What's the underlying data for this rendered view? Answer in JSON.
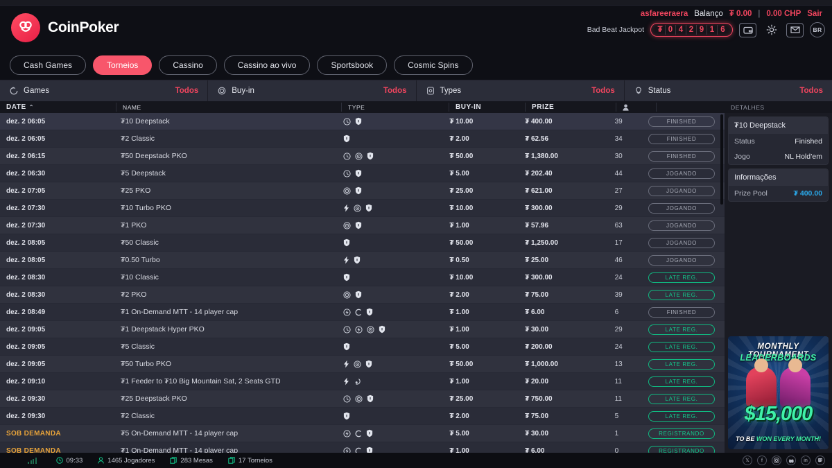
{
  "brand": {
    "name": "CoinPoker"
  },
  "account": {
    "username": "asfareeraera",
    "balance_label": "Balanço",
    "balance_value": "₮ 0.00",
    "separator": "|",
    "chp_value": "0.00 CHP",
    "logout": "Sair"
  },
  "jackpot": {
    "label": "Bad Beat Jackpot",
    "symbol": "₮",
    "digits": [
      "0",
      "4",
      "2",
      "9",
      "1",
      "6"
    ]
  },
  "header_icons": [
    {
      "name": "wallet-icon",
      "label": ""
    },
    {
      "name": "gear-icon",
      "label": ""
    },
    {
      "name": "mail-icon",
      "label": ""
    },
    {
      "name": "language-badge",
      "label": "BR"
    }
  ],
  "nav": {
    "tabs": [
      {
        "label": "Cash Games",
        "active": false
      },
      {
        "label": "Torneios",
        "active": true
      },
      {
        "label": "Cassino",
        "active": false
      },
      {
        "label": "Cassino ao vivo",
        "active": false
      },
      {
        "label": "Sportsbook",
        "active": false
      },
      {
        "label": "Cosmic Spins",
        "active": false
      }
    ]
  },
  "filters": [
    {
      "icon": "games-icon",
      "label": "Games",
      "value": "Todos"
    },
    {
      "icon": "buyin-icon",
      "label": "Buy-in",
      "value": "Todos"
    },
    {
      "icon": "types-icon",
      "label": "Types",
      "value": "Todos"
    },
    {
      "icon": "status-icon",
      "label": "Status",
      "value": "Todos"
    }
  ],
  "table": {
    "columns": {
      "date": "DATE",
      "sort_indicator": "⌃",
      "name": "NAME",
      "type": "TYPE",
      "buyin": "BUY-IN",
      "prize": "PRIZE",
      "players": "",
      "status": ""
    },
    "rows": [
      {
        "date": "dez. 2 06:05",
        "on_demand": false,
        "name": "₮10 Deepstack",
        "types": [
          "clock",
          "shield"
        ],
        "buyin": "₮ 10.00",
        "prize": "₮ 400.00",
        "players": "39",
        "status": "FINISHED",
        "status_color": "grey",
        "selected": true
      },
      {
        "date": "dez. 2 06:05",
        "on_demand": false,
        "name": "₮2 Classic",
        "types": [
          "shield"
        ],
        "buyin": "₮ 2.00",
        "prize": "₮ 62.56",
        "players": "34",
        "status": "FINISHED",
        "status_color": "grey",
        "selected": false
      },
      {
        "date": "dez. 2 06:15",
        "on_demand": false,
        "name": "₮50 Deepstack PKO",
        "types": [
          "clock",
          "target",
          "shield"
        ],
        "buyin": "₮ 50.00",
        "prize": "₮ 1,380.00",
        "players": "30",
        "status": "FINISHED",
        "status_color": "grey",
        "selected": false
      },
      {
        "date": "dez. 2 06:30",
        "on_demand": false,
        "name": "₮5 Deepstack",
        "types": [
          "clock",
          "shield"
        ],
        "buyin": "₮ 5.00",
        "prize": "₮ 202.40",
        "players": "44",
        "status": "JOGANDO",
        "status_color": "grey",
        "selected": false
      },
      {
        "date": "dez. 2 07:05",
        "on_demand": false,
        "name": "₮25 PKO",
        "types": [
          "target",
          "shield"
        ],
        "buyin": "₮ 25.00",
        "prize": "₮ 621.00",
        "players": "27",
        "status": "JOGANDO",
        "status_color": "grey",
        "selected": false
      },
      {
        "date": "dez. 2 07:30",
        "on_demand": false,
        "name": "₮10 Turbo PKO",
        "types": [
          "bolt",
          "target",
          "shield"
        ],
        "buyin": "₮ 10.00",
        "prize": "₮ 300.00",
        "players": "29",
        "status": "JOGANDO",
        "status_color": "grey",
        "selected": false
      },
      {
        "date": "dez. 2 07:30",
        "on_demand": false,
        "name": "₮1 PKO",
        "types": [
          "target",
          "shield"
        ],
        "buyin": "₮ 1.00",
        "prize": "₮ 57.96",
        "players": "63",
        "status": "JOGANDO",
        "status_color": "grey",
        "selected": false
      },
      {
        "date": "dez. 2 08:05",
        "on_demand": false,
        "name": "₮50 Classic",
        "types": [
          "shield"
        ],
        "buyin": "₮ 50.00",
        "prize": "₮ 1,250.00",
        "players": "17",
        "status": "JOGANDO",
        "status_color": "grey",
        "selected": false
      },
      {
        "date": "dez. 2 08:05",
        "on_demand": false,
        "name": "₮0.50 Turbo",
        "types": [
          "bolt",
          "shield"
        ],
        "buyin": "₮ 0.50",
        "prize": "₮ 25.00",
        "players": "46",
        "status": "JOGANDO",
        "status_color": "grey",
        "selected": false
      },
      {
        "date": "dez. 2 08:30",
        "on_demand": false,
        "name": "₮10 Classic",
        "types": [
          "shield"
        ],
        "buyin": "₮ 10.00",
        "prize": "₮ 300.00",
        "players": "24",
        "status": "LATE REG.",
        "status_color": "green",
        "selected": false
      },
      {
        "date": "dez. 2 08:30",
        "on_demand": false,
        "name": "₮2 PKO",
        "types": [
          "target",
          "shield"
        ],
        "buyin": "₮ 2.00",
        "prize": "₮ 75.00",
        "players": "39",
        "status": "LATE REG.",
        "status_color": "green",
        "selected": false
      },
      {
        "date": "dez. 2 08:49",
        "on_demand": false,
        "name": "₮1 On-Demand MTT - 14 player cap",
        "types": [
          "hyper",
          "cap",
          "shield"
        ],
        "buyin": "₮ 1.00",
        "prize": "₮ 6.00",
        "players": "6",
        "status": "FINISHED",
        "status_color": "grey",
        "selected": false
      },
      {
        "date": "dez. 2 09:05",
        "on_demand": false,
        "name": "₮1 Deepstack Hyper PKO",
        "types": [
          "clock",
          "hyper",
          "target",
          "shield"
        ],
        "buyin": "₮ 1.00",
        "prize": "₮ 30.00",
        "players": "29",
        "status": "LATE REG.",
        "status_color": "green",
        "selected": false
      },
      {
        "date": "dez. 2 09:05",
        "on_demand": false,
        "name": "₮5 Classic",
        "types": [
          "shield"
        ],
        "buyin": "₮ 5.00",
        "prize": "₮ 200.00",
        "players": "24",
        "status": "LATE REG.",
        "status_color": "green",
        "selected": false
      },
      {
        "date": "dez. 2 09:05",
        "on_demand": false,
        "name": "₮50 Turbo PKO",
        "types": [
          "bolt",
          "target",
          "shield"
        ],
        "buyin": "₮ 50.00",
        "prize": "₮ 1,000.00",
        "players": "13",
        "status": "LATE REG.",
        "status_color": "green",
        "selected": false
      },
      {
        "date": "dez. 2 09:10",
        "on_demand": false,
        "name": "₮1 Feeder to ₮10 Big Mountain Sat, 2 Seats GTD",
        "types": [
          "bolt",
          "sat"
        ],
        "buyin": "₮ 1.00",
        "prize": "₮ 20.00",
        "players": "11",
        "status": "LATE REG.",
        "status_color": "green",
        "selected": false
      },
      {
        "date": "dez. 2 09:30",
        "on_demand": false,
        "name": "₮25 Deepstack PKO",
        "types": [
          "clock",
          "target",
          "shield"
        ],
        "buyin": "₮ 25.00",
        "prize": "₮ 750.00",
        "players": "11",
        "status": "LATE REG.",
        "status_color": "green",
        "selected": false
      },
      {
        "date": "dez. 2 09:30",
        "on_demand": false,
        "name": "₮2 Classic",
        "types": [
          "shield"
        ],
        "buyin": "₮ 2.00",
        "prize": "₮ 75.00",
        "players": "5",
        "status": "LATE REG.",
        "status_color": "green",
        "selected": false
      },
      {
        "date": "SOB DEMANDA",
        "on_demand": true,
        "name": "₮5 On-Demand MTT - 14 player cap",
        "types": [
          "hyper",
          "cap",
          "shield"
        ],
        "buyin": "₮ 5.00",
        "prize": "₮ 30.00",
        "players": "1",
        "status": "REGISTRANDO",
        "status_color": "green",
        "selected": false
      },
      {
        "date": "SOB DEMANDA",
        "on_demand": true,
        "name": "₮1 On-Demand MTT - 14 player cap",
        "types": [
          "hyper",
          "cap",
          "shield"
        ],
        "buyin": "₮ 1.00",
        "prize": "₮ 6.00",
        "players": "0",
        "status": "REGISTRANDO",
        "status_color": "green",
        "selected": false
      }
    ]
  },
  "details": {
    "header": "DETALHES",
    "tournament_title": "₮10 Deepstack",
    "fields": [
      {
        "key": "Status",
        "value": "Finished"
      },
      {
        "key": "Jogo",
        "value": "NL Hold’em"
      }
    ],
    "info_title": "Informações",
    "info_fields": [
      {
        "key": "Prize Pool",
        "value": "₮ 400.00"
      }
    ]
  },
  "promo": {
    "line1": "MONTHLY TOURNAMENT",
    "line2": "LEADERBOARDS",
    "amount": "$15,000",
    "line3_pre": "TO BE ",
    "line3_em": "WON EVERY MONTH!"
  },
  "statusbar": {
    "time": "09:33",
    "players": "1465 Jogadores",
    "tables": "283 Mesas",
    "tournaments": "17 Torneios",
    "socials": [
      "X",
      "f",
      "ig",
      "dc",
      "in",
      "tw"
    ]
  },
  "colors": {
    "accent_red": "#f0455e",
    "green": "#13c98c",
    "orange": "#e8a33a",
    "blue": "#2aa7e8"
  }
}
